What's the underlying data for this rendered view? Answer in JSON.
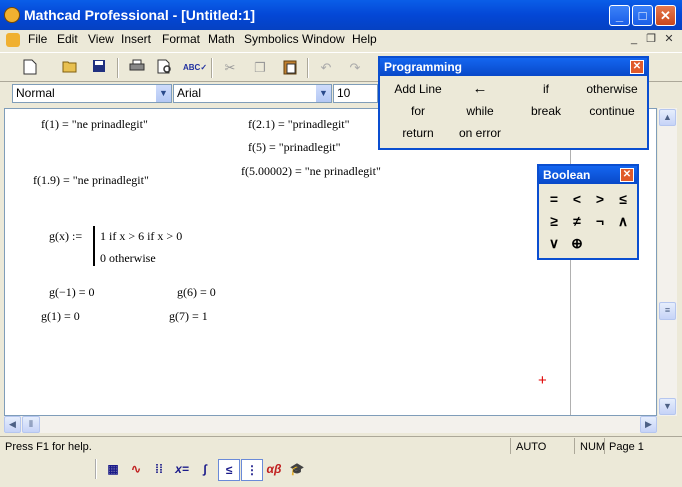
{
  "window": {
    "title": "Mathcad Professional - [Untitled:1]",
    "minimize": "_",
    "maximize": "□",
    "close": "✕"
  },
  "menu": [
    "File",
    "Edit",
    "View",
    "Insert",
    "Format",
    "Math",
    "Symbolics",
    "Window",
    "Help"
  ],
  "mdi": {
    "minimize": "_",
    "restore": "❐",
    "close": "✕"
  },
  "format_bar": {
    "style": "Normal",
    "font": "Arial",
    "size": "10"
  },
  "palettes": {
    "programming": {
      "title": "Programming",
      "buttons": [
        "Add Line",
        "←",
        "if",
        "otherwise",
        "for",
        "while",
        "break",
        "continue",
        "return",
        "on error"
      ]
    },
    "boolean": {
      "title": "Boolean",
      "buttons": [
        "=",
        "<",
        ">",
        "≤",
        "≥",
        "≠",
        "¬",
        "∧",
        "∨",
        "⊕"
      ]
    }
  },
  "worksheet": {
    "eq1": "f(1) = \"ne prinadlegit\"",
    "eq2": "f(2.1) = \"prinadlegit\"",
    "eq3": "f(5) = \"prinadlegit\"",
    "eq4": "f(1.9) = \"ne prinadlegit\"",
    "eq5": "f(5.00002) = \"ne prinadlegit\"",
    "gdef_lhs": "g(x) :=",
    "gdef_line1": "1  if  x > 6  if  x > 0",
    "gdef_line2": "0  otherwise",
    "g1": "g(−1) = 0",
    "g2": "g(6) = 0",
    "g3": "g(1) = 0",
    "g4": "g(7) = 1",
    "cursor": "+"
  },
  "status": {
    "help": "Press F1 for help.",
    "mode": "AUTO",
    "num": "NUM",
    "page": "Page 1"
  },
  "colors": {
    "title_blue": "#0447d6",
    "cursor_red": "#e00000"
  }
}
